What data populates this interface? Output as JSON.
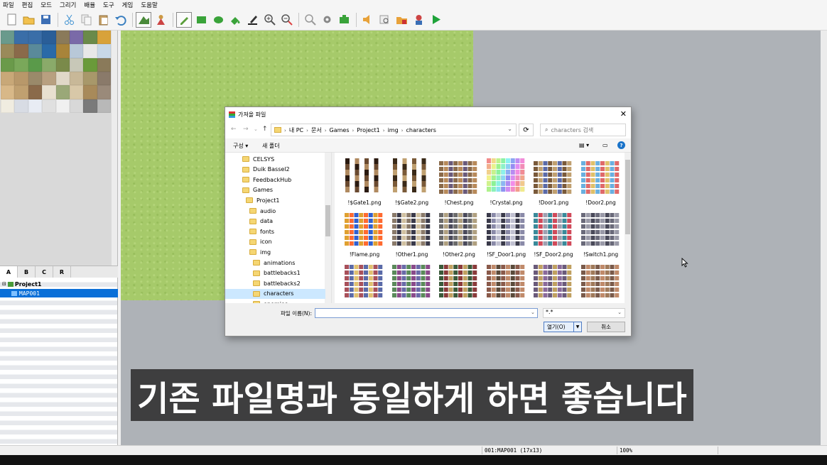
{
  "menu": [
    "파일",
    "편집",
    "모드",
    "그리기",
    "배율",
    "도구",
    "게임",
    "도움말"
  ],
  "toolbar": [
    "new-icon",
    "open-folder-icon",
    "save-icon",
    "cut-icon",
    "copy-icon",
    "paste-icon",
    "undo-icon",
    "map-layer-icon",
    "event-layer-icon",
    "pencil-icon",
    "rectangle-icon",
    "ellipse-icon",
    "fill-icon",
    "shadow-pen-icon",
    "zoom-in-icon",
    "zoom-out-icon",
    "zoom-actual-icon",
    "database-icon",
    "plugin-icon",
    "sound-test-icon",
    "event-search-icon",
    "resource-manager-icon",
    "character-generator-icon",
    "playtest-icon"
  ],
  "tile_tabs": [
    "A",
    "B",
    "C",
    "R"
  ],
  "tree": {
    "project": "Project1",
    "map": "MAP001"
  },
  "dialog": {
    "title": "가져올 파일",
    "breadcrumb": [
      "내 PC",
      "문서",
      "Games",
      "Project1",
      "img",
      "characters"
    ],
    "search_placeholder": "characters 검색",
    "organize": "구성 ▾",
    "new_folder": "새 폴더",
    "folders": [
      {
        "name": "CELSYS",
        "level": 0
      },
      {
        "name": "Duik Bassel2",
        "level": 0
      },
      {
        "name": "FeedbackHub",
        "level": 0
      },
      {
        "name": "Games",
        "level": 0
      },
      {
        "name": "Project1",
        "level": 1
      },
      {
        "name": "audio",
        "level": 2
      },
      {
        "name": "data",
        "level": 2
      },
      {
        "name": "fonts",
        "level": 2
      },
      {
        "name": "icon",
        "level": 2
      },
      {
        "name": "img",
        "level": 2
      },
      {
        "name": "animations",
        "level": 3
      },
      {
        "name": "battlebacks1",
        "level": 3
      },
      {
        "name": "battlebacks2",
        "level": 3
      },
      {
        "name": "characters",
        "level": 3,
        "selected": true
      },
      {
        "name": "enemies",
        "level": 3
      }
    ],
    "files": [
      {
        "name": "!$Gate1.png"
      },
      {
        "name": "!$Gate2.png"
      },
      {
        "name": "!Chest.png"
      },
      {
        "name": "!Crystal.png"
      },
      {
        "name": "!Door1.png"
      },
      {
        "name": "!Door2.png"
      },
      {
        "name": "!Flame.png"
      },
      {
        "name": "!Other1.png"
      },
      {
        "name": "!Other2.png"
      },
      {
        "name": "!SF_Door1.png"
      },
      {
        "name": "!SF_Door2.png"
      },
      {
        "name": "!Switch1.png"
      },
      {
        "name": ""
      },
      {
        "name": ""
      },
      {
        "name": ""
      },
      {
        "name": ""
      },
      {
        "name": ""
      },
      {
        "name": ""
      }
    ],
    "filename_label": "파일 이름(N):",
    "filename_value": "",
    "filter": "*.*",
    "open_label": "열기(O)",
    "cancel_label": "취소"
  },
  "status": {
    "map": "001:MAP001 (17x13)",
    "zoom": "100%"
  },
  "subtitle": "기존 파일명과 동일하게 하면 좋습니다"
}
